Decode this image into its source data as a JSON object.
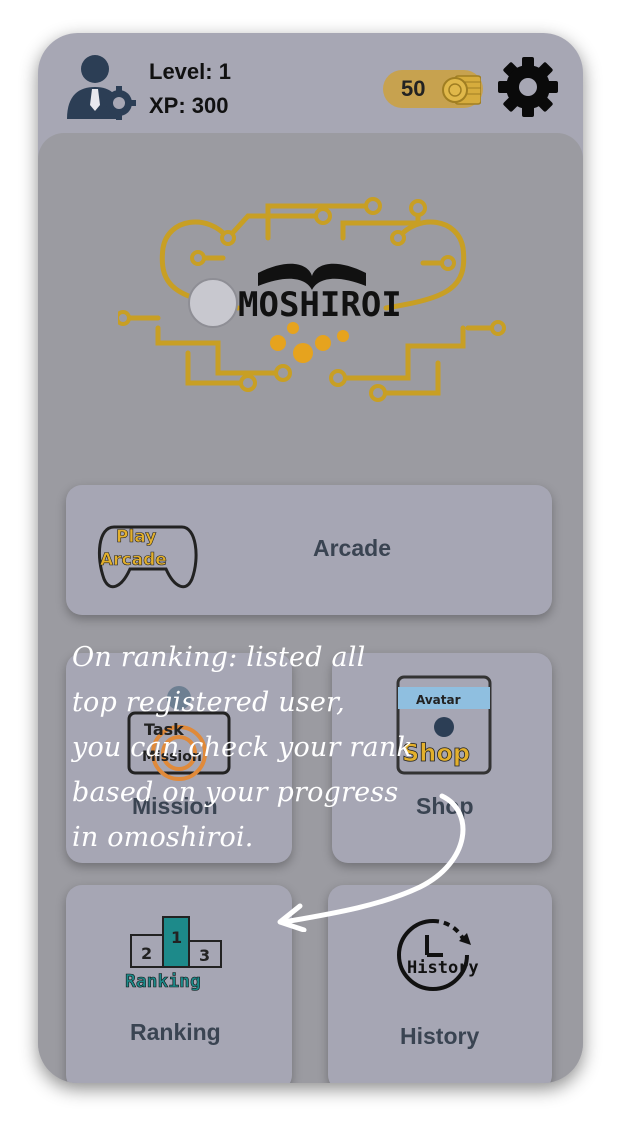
{
  "header": {
    "level_text": "Level: 1",
    "xp_text": "XP: 300",
    "coins": "50",
    "icons": {
      "avatar": "user-gear-icon",
      "settings": "gear-icon",
      "coins": "coin-stack-icon"
    }
  },
  "logo": {
    "text": "MOSHIROI"
  },
  "menu": {
    "arcade": {
      "label": "Arcade",
      "icon_top": "Play",
      "icon_bottom": "Arcade"
    },
    "mission": {
      "label": "Mission",
      "icon_top": "Task",
      "icon_bottom": "Mission"
    },
    "shop": {
      "label": "Shop",
      "icon_top": "Avatar",
      "icon_bottom": "Shop"
    },
    "ranking": {
      "label": "Ranking",
      "icon_text": "Ranking"
    },
    "history": {
      "label": "History",
      "icon_text": "History"
    }
  },
  "tutorial": {
    "lines": [
      "On ranking: listed all",
      "top registered user,",
      "you can check your rank",
      "based on your progress",
      "in omoshiroi."
    ]
  },
  "colors": {
    "panel": "#9b9ba1",
    "card": "#a6a6b4",
    "header": "#a7a7b4",
    "gold": "#d4a22a",
    "label": "#3a4452"
  }
}
